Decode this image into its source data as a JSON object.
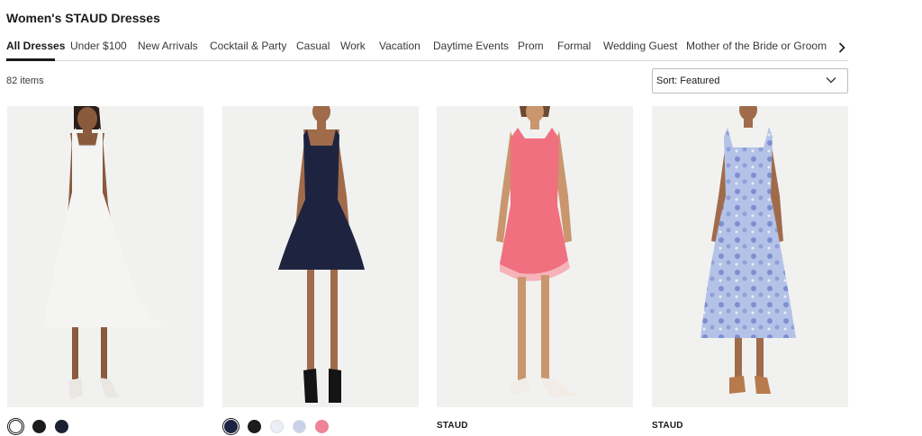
{
  "page": {
    "title": "Women's STAUD Dresses"
  },
  "tabs": [
    {
      "label": "All Dresses",
      "active": true
    },
    {
      "label": "Under $100"
    },
    {
      "label": "New Arrivals"
    },
    {
      "label": "Cocktail & Party"
    },
    {
      "label": "Casual"
    },
    {
      "label": "Work"
    },
    {
      "label": "Vacation"
    },
    {
      "label": "Daytime Events"
    },
    {
      "label": "Prom"
    },
    {
      "label": "Formal"
    },
    {
      "label": "Wedding Guest"
    },
    {
      "label": "Mother of the Bride or Groom"
    }
  ],
  "tabs_next_icon": "chevron-right-icon",
  "results": {
    "count_label": "82 items"
  },
  "sort": {
    "label": "Sort: Featured",
    "icon": "chevron-down-icon"
  },
  "products": [
    {
      "image_desc": "white-dress-photo",
      "dress_color": "#f4f4f2",
      "swatches": [
        "#ffffff",
        "#1c1c1c",
        "#1b2033"
      ],
      "brand": ""
    },
    {
      "image_desc": "navy-dress-photo",
      "dress_color": "#1e2440",
      "swatches": [
        "#1b2340",
        "#1c1c1c",
        "#eceef6",
        "#c9d2ea",
        "#ef8397"
      ],
      "brand": ""
    },
    {
      "image_desc": "pink-dress-photo",
      "dress_color": "#f0707f",
      "swatches": [],
      "brand": "STAUD"
    },
    {
      "image_desc": "blue-floral-dress-photo",
      "dress_color": "#a9b8e2",
      "swatches": [],
      "brand": "STAUD"
    }
  ]
}
